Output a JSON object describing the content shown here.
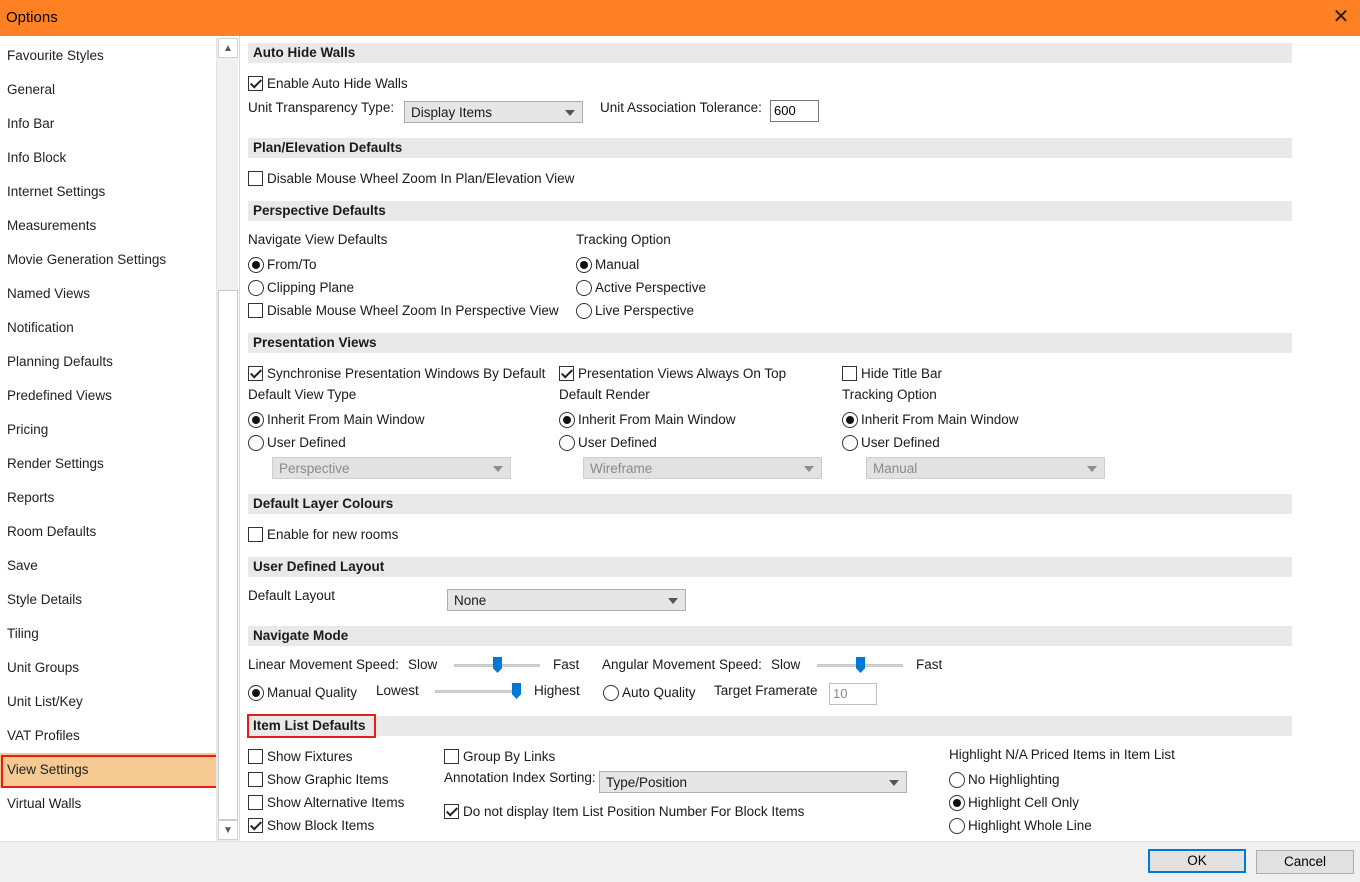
{
  "window": {
    "title": "Options",
    "close_glyph": "✕"
  },
  "sidebar": {
    "selected_index": 22,
    "items": [
      "Favourite Styles",
      "General",
      "Info Bar",
      "Info Block",
      "Internet Settings",
      "Measurements",
      "Movie Generation Settings",
      "Named Views",
      "Notification",
      "Planning Defaults",
      "Predefined Views",
      "Pricing",
      "Render Settings",
      "Reports",
      "Room Defaults",
      "Save",
      "Style Details",
      "Tiling",
      "Unit Groups",
      "Unit List/Key",
      "VAT Profiles",
      "View Settings",
      "Virtual Walls"
    ]
  },
  "auto_hide_walls": {
    "header": "Auto Hide Walls",
    "enable_label": "Enable Auto Hide Walls",
    "enable_checked": true,
    "transparency_label": "Unit Transparency Type:",
    "transparency_value": "Display Items",
    "tolerance_label": "Unit Association Tolerance:",
    "tolerance_value": "600"
  },
  "plan_elevation": {
    "header": "Plan/Elevation Defaults",
    "disable_zoom_label": "Disable Mouse Wheel Zoom In Plan/Elevation View",
    "disable_zoom_checked": false
  },
  "perspective": {
    "header": "Perspective Defaults",
    "navigate_title": "Navigate View Defaults",
    "from_to_label": "From/To",
    "clipping_plane_label": "Clipping Plane",
    "navigate_selected": "From/To",
    "disable_zoom_label": "Disable Mouse Wheel Zoom In Perspective View",
    "disable_zoom_checked": false,
    "tracking_title": "Tracking Option",
    "manual_label": "Manual",
    "active_label": "Active Perspective",
    "live_label": "Live Perspective",
    "tracking_selected": "Manual"
  },
  "presentation": {
    "header": "Presentation Views",
    "sync_label": "Synchronise Presentation Windows By Default",
    "sync_checked": true,
    "on_top_label": "Presentation Views Always On Top",
    "on_top_checked": true,
    "hide_title_label": "Hide Title Bar",
    "hide_title_checked": false,
    "view_type_title": "Default View Type",
    "render_title": "Default Render",
    "tracking_title": "Tracking Option",
    "inherit_label": "Inherit From Main Window",
    "user_defined_label": "User Defined",
    "view_type_value": "Perspective",
    "render_value": "Wireframe",
    "tracking_value": "Manual"
  },
  "layer_colours": {
    "header": "Default Layer Colours",
    "enable_label": "Enable for new rooms",
    "enable_checked": false
  },
  "user_layout": {
    "header": "User Defined Layout",
    "label": "Default Layout",
    "value": "None"
  },
  "navigate_mode": {
    "header": "Navigate Mode",
    "linear_label": "Linear Movement Speed:",
    "angular_label": "Angular Movement Speed:",
    "slow": "Slow",
    "fast": "Fast",
    "linear_value": 0.5,
    "angular_value": 0.5,
    "manual_quality_label": "Manual Quality",
    "lowest": "Lowest",
    "highest": "Highest",
    "quality_value": 1.0,
    "auto_quality_label": "Auto Quality",
    "quality_selected": "Manual Quality",
    "framerate_label": "Target Framerate",
    "framerate_value": "10"
  },
  "item_list": {
    "header": "Item List Defaults",
    "show_fixtures": "Show Fixtures",
    "show_graphic": "Show Graphic Items",
    "show_alternative": "Show Alternative Items",
    "show_block": "Show Block Items",
    "show_block_checked": true,
    "group_links": "Group By Links",
    "annotation_label": "Annotation Index Sorting:",
    "annotation_value": "Type/Position",
    "no_position_label": "Do not display Item List Position Number For Block Items",
    "no_position_checked": true,
    "highlight_title": "Highlight N/A Priced Items in Item List",
    "no_highlighting": "No Highlighting",
    "highlight_cell": "Highlight Cell Only",
    "highlight_line": "Highlight Whole Line",
    "highlight_selected": "Highlight Cell Only"
  },
  "footer": {
    "ok": "OK",
    "cancel": "Cancel"
  },
  "colors": {
    "titlebar": "#ff8124",
    "selection": "#f5c992",
    "annotation": "#e31d1d",
    "accent": "#0078d7"
  }
}
